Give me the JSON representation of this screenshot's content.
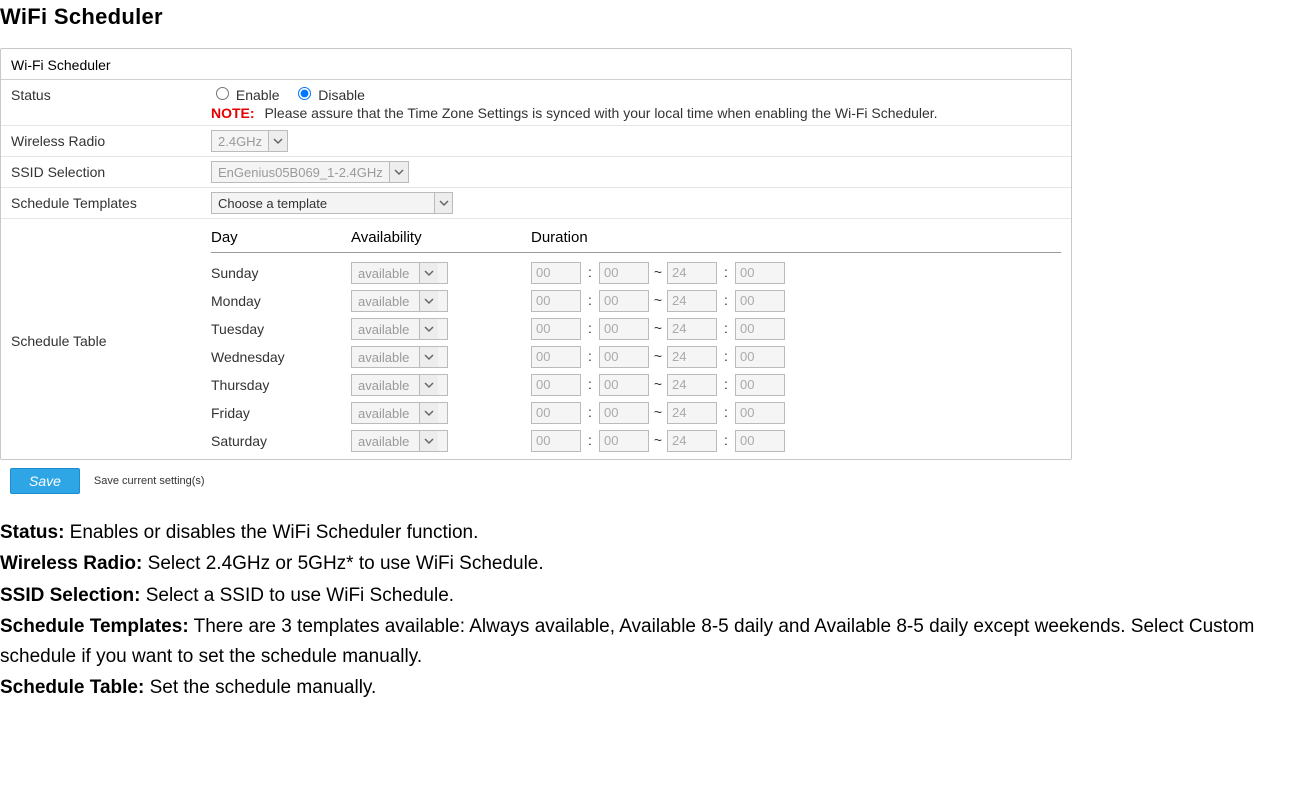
{
  "page_title": "WiFi Scheduler",
  "panel_title": "Wi-Fi Scheduler",
  "status": {
    "label": "Status",
    "enable_label": "Enable",
    "disable_label": "Disable",
    "selected": "disable",
    "note_label": "NOTE:",
    "note_text": "Please assure that the Time Zone Settings is synced with your local time when enabling the Wi-Fi Scheduler."
  },
  "wireless_radio": {
    "label": "Wireless Radio",
    "value": "2.4GHz"
  },
  "ssid_selection": {
    "label": "SSID Selection",
    "value": "EnGenius05B069_1-2.4GHz"
  },
  "schedule_templates": {
    "label": "Schedule Templates",
    "value": "Choose a template"
  },
  "schedule_table": {
    "label": "Schedule Table",
    "header_day": "Day",
    "header_avail": "Availability",
    "header_duration": "Duration",
    "rows": [
      {
        "day": "Sunday",
        "avail": "available",
        "sh": "00",
        "sm": "00",
        "eh": "24",
        "em": "00"
      },
      {
        "day": "Monday",
        "avail": "available",
        "sh": "00",
        "sm": "00",
        "eh": "24",
        "em": "00"
      },
      {
        "day": "Tuesday",
        "avail": "available",
        "sh": "00",
        "sm": "00",
        "eh": "24",
        "em": "00"
      },
      {
        "day": "Wednesday",
        "avail": "available",
        "sh": "00",
        "sm": "00",
        "eh": "24",
        "em": "00"
      },
      {
        "day": "Thursday",
        "avail": "available",
        "sh": "00",
        "sm": "00",
        "eh": "24",
        "em": "00"
      },
      {
        "day": "Friday",
        "avail": "available",
        "sh": "00",
        "sm": "00",
        "eh": "24",
        "em": "00"
      },
      {
        "day": "Saturday",
        "avail": "available",
        "sh": "00",
        "sm": "00",
        "eh": "24",
        "em": "00"
      }
    ]
  },
  "save": {
    "button": "Save",
    "caption": "Save current setting(s)"
  },
  "descriptions": {
    "status": {
      "label": "Status:",
      "text": " Enables or disables the WiFi Scheduler function."
    },
    "wireless_radio": {
      "label": "Wireless Radio:",
      "text": " Select 2.4GHz or 5GHz* to use WiFi Schedule."
    },
    "ssid_selection": {
      "label": "SSID Selection:",
      "text": " Select a SSID to use WiFi Schedule."
    },
    "schedule_templates": {
      "label": "Schedule Templates:",
      "text": " There are 3 templates available: Always available, Available 8-5 daily and Available 8-5 daily except weekends. Select Custom schedule if you want to set the schedule manually."
    },
    "schedule_table": {
      "label": "Schedule Table:",
      "text": " Set the schedule manually."
    }
  }
}
